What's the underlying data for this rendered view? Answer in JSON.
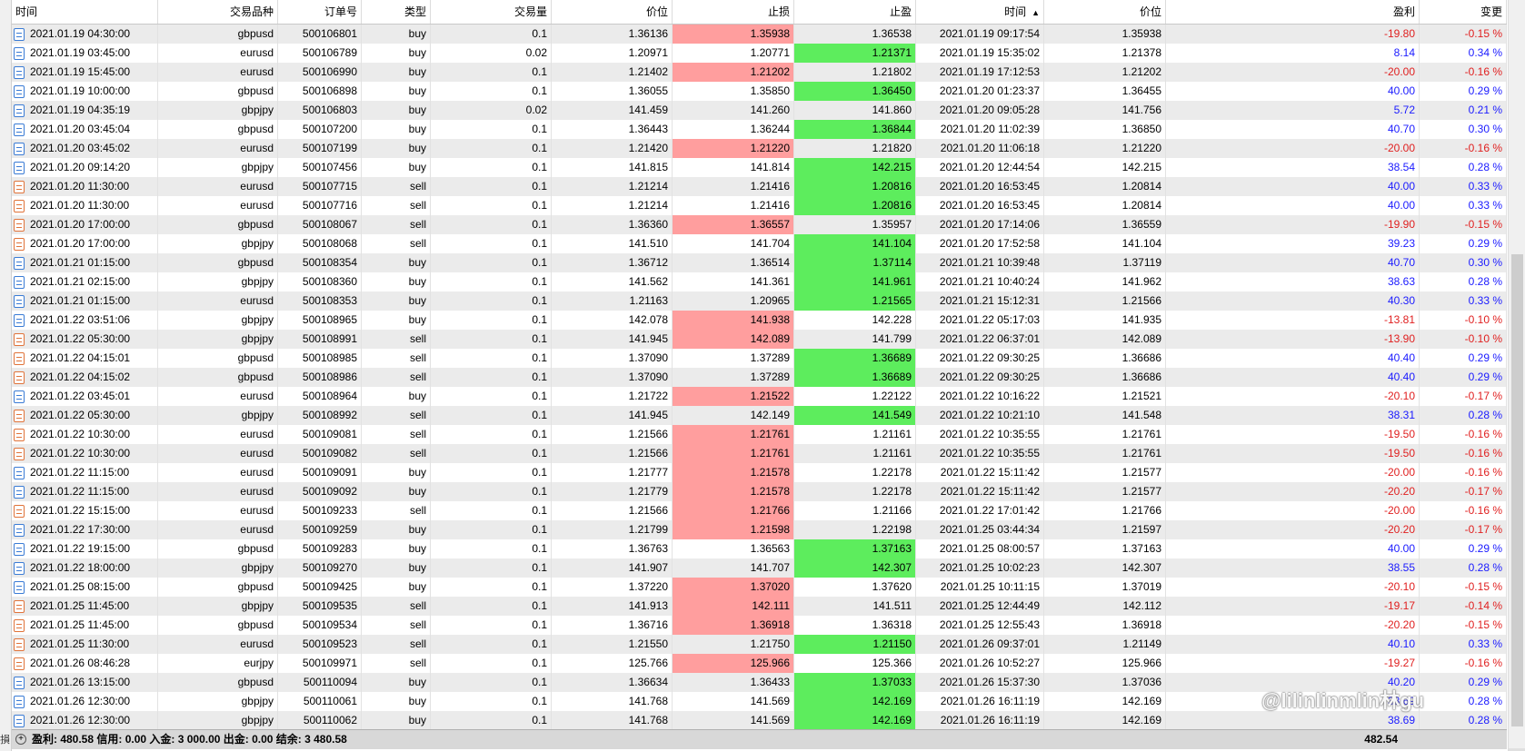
{
  "headers": {
    "time": "时间",
    "symbol": "交易品种",
    "order": "订单号",
    "type": "类型",
    "volume": "交易量",
    "price": "价位",
    "sl": "止损",
    "tp": "止盈",
    "close_time": "时间",
    "close_price": "价位",
    "profit": "盈利",
    "change": "变更"
  },
  "sort_indicator": "▲",
  "colors": {
    "sl_hit": "#ff9e9e",
    "tp_hit": "#5ded5d",
    "profit_positive": "#1a1aff",
    "profit_negative": "#e02020",
    "row_alt": "#ebebeb"
  },
  "rows": [
    {
      "time": "2021.01.19 04:30:00",
      "symbol": "gbpusd",
      "order": "500106801",
      "type": "buy",
      "volume": "0.1",
      "price": "1.36136",
      "sl": "1.35938",
      "tp": "1.36538",
      "close_time": "2021.01.19 09:17:54",
      "close_price": "1.35938",
      "profit": "-19.80",
      "change": "-0.15 %",
      "hit": "sl"
    },
    {
      "time": "2021.01.19 03:45:00",
      "symbol": "eurusd",
      "order": "500106789",
      "type": "buy",
      "volume": "0.02",
      "price": "1.20971",
      "sl": "1.20771",
      "tp": "1.21371",
      "close_time": "2021.01.19 15:35:02",
      "close_price": "1.21378",
      "profit": "8.14",
      "change": "0.34 %",
      "hit": "tp"
    },
    {
      "time": "2021.01.19 15:45:00",
      "symbol": "eurusd",
      "order": "500106990",
      "type": "buy",
      "volume": "0.1",
      "price": "1.21402",
      "sl": "1.21202",
      "tp": "1.21802",
      "close_time": "2021.01.19 17:12:53",
      "close_price": "1.21202",
      "profit": "-20.00",
      "change": "-0.16 %",
      "hit": "sl"
    },
    {
      "time": "2021.01.19 10:00:00",
      "symbol": "gbpusd",
      "order": "500106898",
      "type": "buy",
      "volume": "0.1",
      "price": "1.36055",
      "sl": "1.35850",
      "tp": "1.36450",
      "close_time": "2021.01.20 01:23:37",
      "close_price": "1.36455",
      "profit": "40.00",
      "change": "0.29 %",
      "hit": "tp"
    },
    {
      "time": "2021.01.19 04:35:19",
      "symbol": "gbpjpy",
      "order": "500106803",
      "type": "buy",
      "volume": "0.02",
      "price": "141.459",
      "sl": "141.260",
      "tp": "141.860",
      "close_time": "2021.01.20 09:05:28",
      "close_price": "141.756",
      "profit": "5.72",
      "change": "0.21 %",
      "hit": ""
    },
    {
      "time": "2021.01.20 03:45:04",
      "symbol": "gbpusd",
      "order": "500107200",
      "type": "buy",
      "volume": "0.1",
      "price": "1.36443",
      "sl": "1.36244",
      "tp": "1.36844",
      "close_time": "2021.01.20 11:02:39",
      "close_price": "1.36850",
      "profit": "40.70",
      "change": "0.30 %",
      "hit": "tp"
    },
    {
      "time": "2021.01.20 03:45:02",
      "symbol": "eurusd",
      "order": "500107199",
      "type": "buy",
      "volume": "0.1",
      "price": "1.21420",
      "sl": "1.21220",
      "tp": "1.21820",
      "close_time": "2021.01.20 11:06:18",
      "close_price": "1.21220",
      "profit": "-20.00",
      "change": "-0.16 %",
      "hit": "sl"
    },
    {
      "time": "2021.01.20 09:14:20",
      "symbol": "gbpjpy",
      "order": "500107456",
      "type": "buy",
      "volume": "0.1",
      "price": "141.815",
      "sl": "141.814",
      "tp": "142.215",
      "close_time": "2021.01.20 12:44:54",
      "close_price": "142.215",
      "profit": "38.54",
      "change": "0.28 %",
      "hit": "tp"
    },
    {
      "time": "2021.01.20 11:30:00",
      "symbol": "eurusd",
      "order": "500107715",
      "type": "sell",
      "volume": "0.1",
      "price": "1.21214",
      "sl": "1.21416",
      "tp": "1.20816",
      "close_time": "2021.01.20 16:53:45",
      "close_price": "1.20814",
      "profit": "40.00",
      "change": "0.33 %",
      "hit": "tp"
    },
    {
      "time": "2021.01.20 11:30:00",
      "symbol": "eurusd",
      "order": "500107716",
      "type": "sell",
      "volume": "0.1",
      "price": "1.21214",
      "sl": "1.21416",
      "tp": "1.20816",
      "close_time": "2021.01.20 16:53:45",
      "close_price": "1.20814",
      "profit": "40.00",
      "change": "0.33 %",
      "hit": "tp"
    },
    {
      "time": "2021.01.20 17:00:00",
      "symbol": "gbpusd",
      "order": "500108067",
      "type": "sell",
      "volume": "0.1",
      "price": "1.36360",
      "sl": "1.36557",
      "tp": "1.35957",
      "close_time": "2021.01.20 17:14:06",
      "close_price": "1.36559",
      "profit": "-19.90",
      "change": "-0.15 %",
      "hit": "sl"
    },
    {
      "time": "2021.01.20 17:00:00",
      "symbol": "gbpjpy",
      "order": "500108068",
      "type": "sell",
      "volume": "0.1",
      "price": "141.510",
      "sl": "141.704",
      "tp": "141.104",
      "close_time": "2021.01.20 17:52:58",
      "close_price": "141.104",
      "profit": "39.23",
      "change": "0.29 %",
      "hit": "tp"
    },
    {
      "time": "2021.01.21 01:15:00",
      "symbol": "gbpusd",
      "order": "500108354",
      "type": "buy",
      "volume": "0.1",
      "price": "1.36712",
      "sl": "1.36514",
      "tp": "1.37114",
      "close_time": "2021.01.21 10:39:48",
      "close_price": "1.37119",
      "profit": "40.70",
      "change": "0.30 %",
      "hit": "tp"
    },
    {
      "time": "2021.01.21 02:15:00",
      "symbol": "gbpjpy",
      "order": "500108360",
      "type": "buy",
      "volume": "0.1",
      "price": "141.562",
      "sl": "141.361",
      "tp": "141.961",
      "close_time": "2021.01.21 10:40:24",
      "close_price": "141.962",
      "profit": "38.63",
      "change": "0.28 %",
      "hit": "tp"
    },
    {
      "time": "2021.01.21 01:15:00",
      "symbol": "eurusd",
      "order": "500108353",
      "type": "buy",
      "volume": "0.1",
      "price": "1.21163",
      "sl": "1.20965",
      "tp": "1.21565",
      "close_time": "2021.01.21 15:12:31",
      "close_price": "1.21566",
      "profit": "40.30",
      "change": "0.33 %",
      "hit": "tp"
    },
    {
      "time": "2021.01.22 03:51:06",
      "symbol": "gbpjpy",
      "order": "500108965",
      "type": "buy",
      "volume": "0.1",
      "price": "142.078",
      "sl": "141.938",
      "tp": "142.228",
      "close_time": "2021.01.22 05:17:03",
      "close_price": "141.935",
      "profit": "-13.81",
      "change": "-0.10 %",
      "hit": "sl"
    },
    {
      "time": "2021.01.22 05:30:00",
      "symbol": "gbpjpy",
      "order": "500108991",
      "type": "sell",
      "volume": "0.1",
      "price": "141.945",
      "sl": "142.089",
      "tp": "141.799",
      "close_time": "2021.01.22 06:37:01",
      "close_price": "142.089",
      "profit": "-13.90",
      "change": "-0.10 %",
      "hit": "sl"
    },
    {
      "time": "2021.01.22 04:15:01",
      "symbol": "gbpusd",
      "order": "500108985",
      "type": "sell",
      "volume": "0.1",
      "price": "1.37090",
      "sl": "1.37289",
      "tp": "1.36689",
      "close_time": "2021.01.22 09:30:25",
      "close_price": "1.36686",
      "profit": "40.40",
      "change": "0.29 %",
      "hit": "tp"
    },
    {
      "time": "2021.01.22 04:15:02",
      "symbol": "gbpusd",
      "order": "500108986",
      "type": "sell",
      "volume": "0.1",
      "price": "1.37090",
      "sl": "1.37289",
      "tp": "1.36689",
      "close_time": "2021.01.22 09:30:25",
      "close_price": "1.36686",
      "profit": "40.40",
      "change": "0.29 %",
      "hit": "tp"
    },
    {
      "time": "2021.01.22 03:45:01",
      "symbol": "eurusd",
      "order": "500108964",
      "type": "buy",
      "volume": "0.1",
      "price": "1.21722",
      "sl": "1.21522",
      "tp": "1.22122",
      "close_time": "2021.01.22 10:16:22",
      "close_price": "1.21521",
      "profit": "-20.10",
      "change": "-0.17 %",
      "hit": "sl"
    },
    {
      "time": "2021.01.22 05:30:00",
      "symbol": "gbpjpy",
      "order": "500108992",
      "type": "sell",
      "volume": "0.1",
      "price": "141.945",
      "sl": "142.149",
      "tp": "141.549",
      "close_time": "2021.01.22 10:21:10",
      "close_price": "141.548",
      "profit": "38.31",
      "change": "0.28 %",
      "hit": "tp"
    },
    {
      "time": "2021.01.22 10:30:00",
      "symbol": "eurusd",
      "order": "500109081",
      "type": "sell",
      "volume": "0.1",
      "price": "1.21566",
      "sl": "1.21761",
      "tp": "1.21161",
      "close_time": "2021.01.22 10:35:55",
      "close_price": "1.21761",
      "profit": "-19.50",
      "change": "-0.16 %",
      "hit": "sl"
    },
    {
      "time": "2021.01.22 10:30:00",
      "symbol": "eurusd",
      "order": "500109082",
      "type": "sell",
      "volume": "0.1",
      "price": "1.21566",
      "sl": "1.21761",
      "tp": "1.21161",
      "close_time": "2021.01.22 10:35:55",
      "close_price": "1.21761",
      "profit": "-19.50",
      "change": "-0.16 %",
      "hit": "sl"
    },
    {
      "time": "2021.01.22 11:15:00",
      "symbol": "eurusd",
      "order": "500109091",
      "type": "buy",
      "volume": "0.1",
      "price": "1.21777",
      "sl": "1.21578",
      "tp": "1.22178",
      "close_time": "2021.01.22 15:11:42",
      "close_price": "1.21577",
      "profit": "-20.00",
      "change": "-0.16 %",
      "hit": "sl"
    },
    {
      "time": "2021.01.22 11:15:00",
      "symbol": "eurusd",
      "order": "500109092",
      "type": "buy",
      "volume": "0.1",
      "price": "1.21779",
      "sl": "1.21578",
      "tp": "1.22178",
      "close_time": "2021.01.22 15:11:42",
      "close_price": "1.21577",
      "profit": "-20.20",
      "change": "-0.17 %",
      "hit": "sl"
    },
    {
      "time": "2021.01.22 15:15:00",
      "symbol": "eurusd",
      "order": "500109233",
      "type": "sell",
      "volume": "0.1",
      "price": "1.21566",
      "sl": "1.21766",
      "tp": "1.21166",
      "close_time": "2021.01.22 17:01:42",
      "close_price": "1.21766",
      "profit": "-20.00",
      "change": "-0.16 %",
      "hit": "sl"
    },
    {
      "time": "2021.01.22 17:30:00",
      "symbol": "eurusd",
      "order": "500109259",
      "type": "buy",
      "volume": "0.1",
      "price": "1.21799",
      "sl": "1.21598",
      "tp": "1.22198",
      "close_time": "2021.01.25 03:44:34",
      "close_price": "1.21597",
      "profit": "-20.20",
      "change": "-0.17 %",
      "hit": "sl"
    },
    {
      "time": "2021.01.22 19:15:00",
      "symbol": "gbpusd",
      "order": "500109283",
      "type": "buy",
      "volume": "0.1",
      "price": "1.36763",
      "sl": "1.36563",
      "tp": "1.37163",
      "close_time": "2021.01.25 08:00:57",
      "close_price": "1.37163",
      "profit": "40.00",
      "change": "0.29 %",
      "hit": "tp"
    },
    {
      "time": "2021.01.22 18:00:00",
      "symbol": "gbpjpy",
      "order": "500109270",
      "type": "buy",
      "volume": "0.1",
      "price": "141.907",
      "sl": "141.707",
      "tp": "142.307",
      "close_time": "2021.01.25 10:02:23",
      "close_price": "142.307",
      "profit": "38.55",
      "change": "0.28 %",
      "hit": "tp"
    },
    {
      "time": "2021.01.25 08:15:00",
      "symbol": "gbpusd",
      "order": "500109425",
      "type": "buy",
      "volume": "0.1",
      "price": "1.37220",
      "sl": "1.37020",
      "tp": "1.37620",
      "close_time": "2021.01.25 10:11:15",
      "close_price": "1.37019",
      "profit": "-20.10",
      "change": "-0.15 %",
      "hit": "sl"
    },
    {
      "time": "2021.01.25 11:45:00",
      "symbol": "gbpjpy",
      "order": "500109535",
      "type": "sell",
      "volume": "0.1",
      "price": "141.913",
      "sl": "142.111",
      "tp": "141.511",
      "close_time": "2021.01.25 12:44:49",
      "close_price": "142.112",
      "profit": "-19.17",
      "change": "-0.14 %",
      "hit": "sl"
    },
    {
      "time": "2021.01.25 11:45:00",
      "symbol": "gbpusd",
      "order": "500109534",
      "type": "sell",
      "volume": "0.1",
      "price": "1.36716",
      "sl": "1.36918",
      "tp": "1.36318",
      "close_time": "2021.01.25 12:55:43",
      "close_price": "1.36918",
      "profit": "-20.20",
      "change": "-0.15 %",
      "hit": "sl"
    },
    {
      "time": "2021.01.25 11:30:00",
      "symbol": "eurusd",
      "order": "500109523",
      "type": "sell",
      "volume": "0.1",
      "price": "1.21550",
      "sl": "1.21750",
      "tp": "1.21150",
      "close_time": "2021.01.26 09:37:01",
      "close_price": "1.21149",
      "profit": "40.10",
      "change": "0.33 %",
      "hit": "tp"
    },
    {
      "time": "2021.01.26 08:46:28",
      "symbol": "eurjpy",
      "order": "500109971",
      "type": "sell",
      "volume": "0.1",
      "price": "125.766",
      "sl": "125.966",
      "tp": "125.366",
      "close_time": "2021.01.26 10:52:27",
      "close_price": "125.966",
      "profit": "-19.27",
      "change": "-0.16 %",
      "hit": "sl"
    },
    {
      "time": "2021.01.26 13:15:00",
      "symbol": "gbpusd",
      "order": "500110094",
      "type": "buy",
      "volume": "0.1",
      "price": "1.36634",
      "sl": "1.36433",
      "tp": "1.37033",
      "close_time": "2021.01.26 15:37:30",
      "close_price": "1.37036",
      "profit": "40.20",
      "change": "0.29 %",
      "hit": "tp"
    },
    {
      "time": "2021.01.26 12:30:00",
      "symbol": "gbpjpy",
      "order": "500110061",
      "type": "buy",
      "volume": "0.1",
      "price": "141.768",
      "sl": "141.569",
      "tp": "142.169",
      "close_time": "2021.01.26 16:11:19",
      "close_price": "142.169",
      "profit": "38.69",
      "change": "0.28 %",
      "hit": "tp"
    },
    {
      "time": "2021.01.26 12:30:00",
      "symbol": "gbpjpy",
      "order": "500110062",
      "type": "buy",
      "volume": "0.1",
      "price": "141.768",
      "sl": "141.569",
      "tp": "142.169",
      "close_time": "2021.01.26 16:11:19",
      "close_price": "142.169",
      "profit": "38.69",
      "change": "0.28 %",
      "hit": "tp"
    }
  ],
  "summary": {
    "text": "盈利: 480.58  信用: 0.00  入金: 3 000.00  出金: 0.00  结余: 3 480.58",
    "total": "482.54",
    "side_char": "損"
  },
  "watermark": "@lilinlinmlin林gu"
}
